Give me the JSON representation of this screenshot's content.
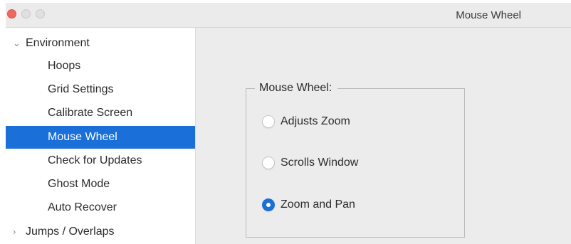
{
  "window": {
    "title": "Mouse Wheel"
  },
  "sidebar": {
    "groups": [
      {
        "label": "Environment",
        "expanded": true,
        "disclosure": "⌄"
      },
      {
        "label": "Jumps / Overlaps",
        "expanded": false,
        "disclosure": "›"
      }
    ],
    "items": [
      {
        "label": "Hoops",
        "selected": false
      },
      {
        "label": "Grid Settings",
        "selected": false
      },
      {
        "label": "Calibrate Screen",
        "selected": false
      },
      {
        "label": "Mouse Wheel",
        "selected": true
      },
      {
        "label": "Check for Updates",
        "selected": false
      },
      {
        "label": "Ghost Mode",
        "selected": false
      },
      {
        "label": "Auto Recover",
        "selected": false
      }
    ]
  },
  "main": {
    "group_label": "Mouse Wheel:",
    "options": [
      {
        "label": "Adjusts Zoom",
        "checked": false
      },
      {
        "label": "Scrolls Window",
        "checked": false
      },
      {
        "label": "Zoom and Pan",
        "checked": true
      }
    ]
  },
  "colors": {
    "selection": "#1a6fd9",
    "close_button": "#ee6a5f"
  }
}
